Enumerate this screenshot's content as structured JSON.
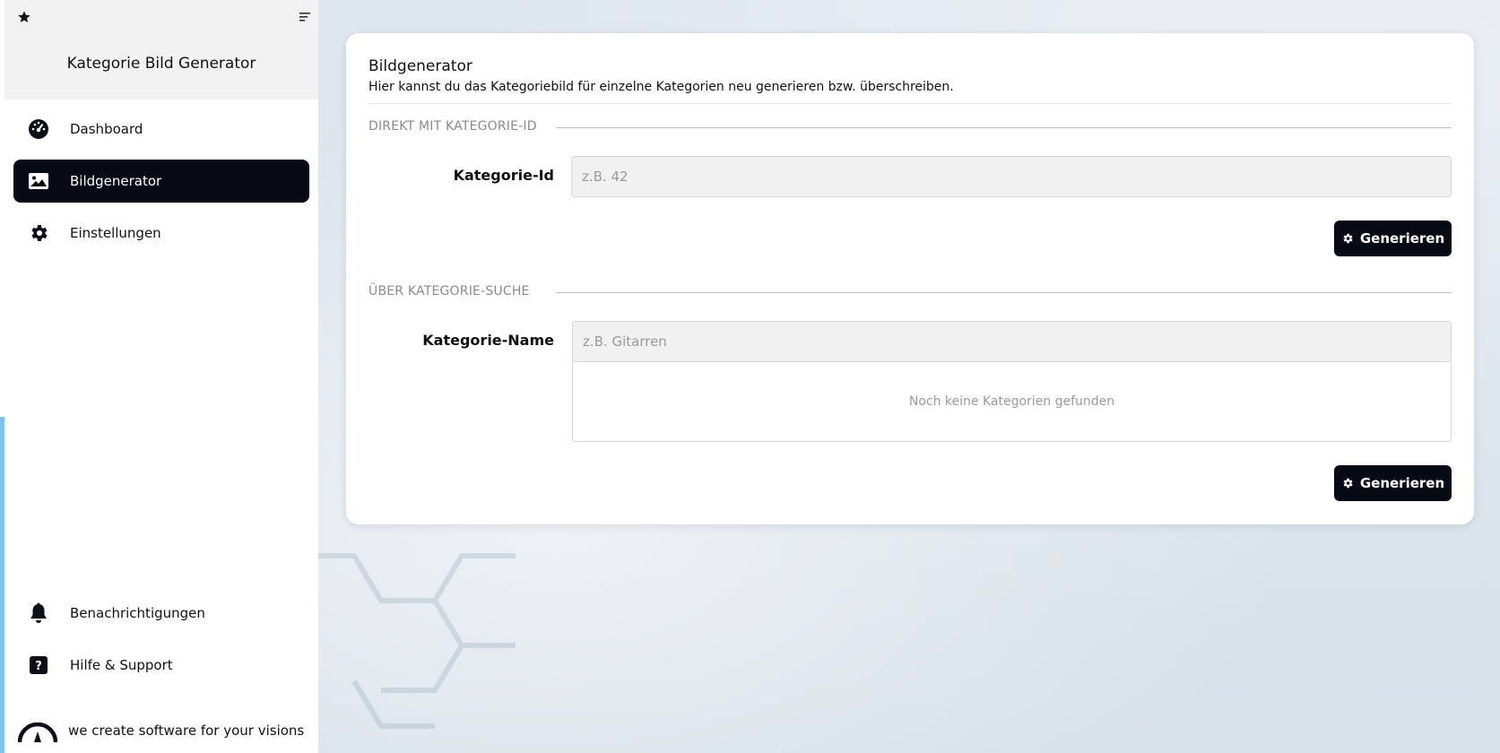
{
  "sidebar": {
    "app_title": "Kategorie Bild Generator",
    "nav_items": [
      {
        "label": "Dashboard",
        "icon": "dashboard-gauge-icon"
      },
      {
        "label": "Bildgenerator",
        "icon": "image-icon",
        "active": true
      },
      {
        "label": "Einstellungen",
        "icon": "gear-icon"
      }
    ],
    "bottom_items": [
      {
        "label": "Benachrichtigungen",
        "icon": "bell-icon"
      },
      {
        "label": "Hilfe & Support",
        "icon": "question-icon"
      }
    ],
    "brand_tagline": "we create software for your visions"
  },
  "card": {
    "title": "Bildgenerator",
    "description": "Hier kannst du das Kategoriebild für einzelne Kategorien neu generieren bzw. überschreiben.",
    "section_id": {
      "label": "DIREKT MIT KATEGORIE-ID",
      "field_label": "Kategorie-Id",
      "placeholder": "z.B. 42",
      "button_label": "Generieren"
    },
    "section_search": {
      "label": "ÜBER KATEGORIE-SUCHE",
      "field_label": "Kategorie-Name",
      "placeholder": "z.B. Gitarren",
      "empty_text": "Noch keine Kategorien gefunden",
      "button_label": "Generieren"
    }
  },
  "colors": {
    "accent_dark": "#050a14",
    "sidebar_accent": "#7cc3f2",
    "background": "#dde6ee"
  }
}
